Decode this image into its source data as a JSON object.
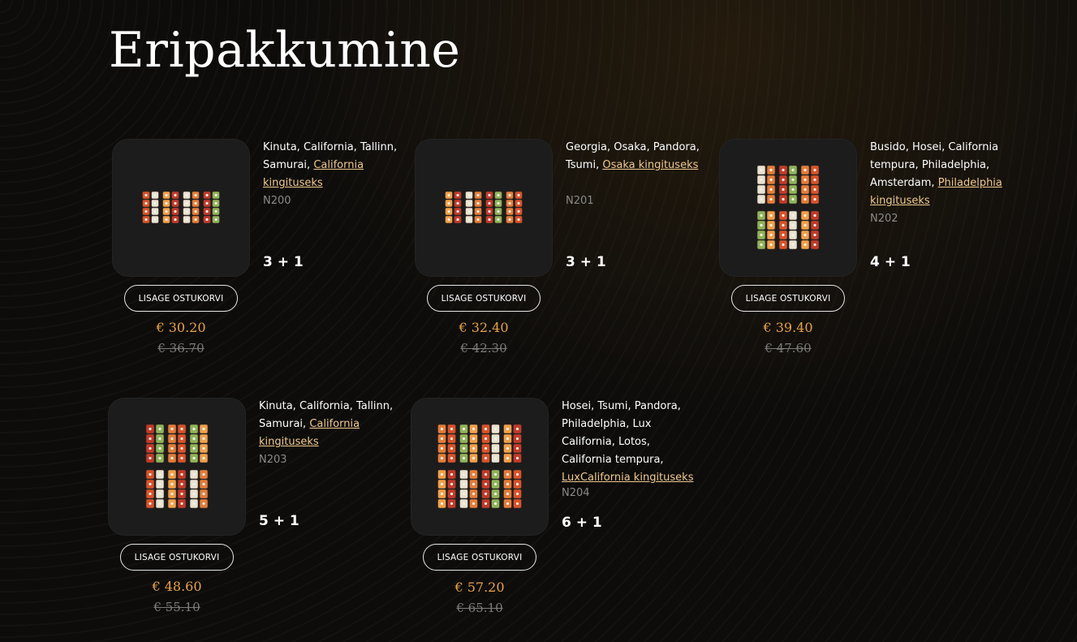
{
  "page": {
    "title": "Eripakkumine"
  },
  "colors": {
    "accent_price": "#e8a24a",
    "gift_link": "#f0c98e",
    "old_price": "#7c7c7c",
    "background": "#0d0c0b"
  },
  "products": [
    {
      "desc_text": "Kinuta, California, Tallinn, Samurai, ",
      "gift_link": "California kingituseks",
      "code": "N200",
      "combo": "3 + 1",
      "add_label": "LISAGE OSTUKORVI",
      "price": "€ 30.20",
      "old_price": "€ 36.70",
      "image_icon": "sushi-set-icon"
    },
    {
      "desc_text": "Georgia, Osaka, Pandora, Tsumi, ",
      "gift_link": "Osaka kingituseks",
      "code": "N201",
      "combo": "3 + 1",
      "add_label": "LISAGE OSTUKORVI",
      "price": "€ 32.40",
      "old_price": "€ 42.30",
      "image_icon": "sushi-set-icon"
    },
    {
      "desc_text": "Busido, Hosei, California tempura, Philadelphia, Amsterdam, ",
      "gift_link": "Philadelphia kingituseks",
      "code": "N202",
      "combo": "4 + 1",
      "add_label": "LISAGE OSTUKORVI",
      "price": "€ 39.40",
      "old_price": "€ 47.60",
      "image_icon": "sushi-set-icon"
    },
    {
      "desc_text": "Kinuta, California, Tallinn, Samurai, ",
      "gift_link": "California kingituseks",
      "code": "N203",
      "combo": "5 + 1",
      "add_label": "LISAGE OSTUKORVI",
      "price": "€ 48.60",
      "old_price": "€ 55.10",
      "image_icon": "sushi-set-icon"
    },
    {
      "desc_text": "Hosei, Tsumi, Pandora, Philadelphia, Lux California, Lotos, California tempura, ",
      "gift_link": "LuxCalifornia kingituseks",
      "code": "N204",
      "combo": "6 + 1",
      "add_label": "LISAGE OSTUKORVI",
      "price": "€ 57.20",
      "old_price": "€ 65.10",
      "image_icon": "sushi-set-icon"
    }
  ]
}
